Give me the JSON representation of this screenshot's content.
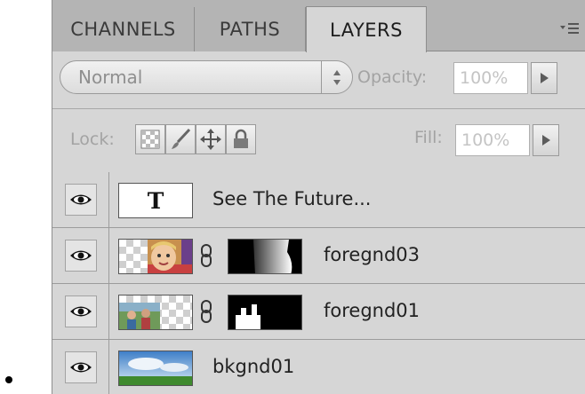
{
  "tabs": [
    {
      "label": "CHANNELS",
      "active": false
    },
    {
      "label": "PATHS",
      "active": false
    },
    {
      "label": "LAYERS",
      "active": true
    }
  ],
  "blend_mode": {
    "value": "Normal"
  },
  "opacity": {
    "label": "Opacity:",
    "value": "100%"
  },
  "lock": {
    "label": "Lock:",
    "buttons": [
      "lock-transparency-icon",
      "lock-paint-icon",
      "lock-move-icon",
      "lock-all-icon"
    ]
  },
  "fill": {
    "label": "Fill:",
    "value": "100%"
  },
  "layers": [
    {
      "name": "See The Future...",
      "type": "text",
      "thumb_glyph": "T",
      "visible": true,
      "has_mask": false
    },
    {
      "name": "foregnd03",
      "type": "image",
      "visible": true,
      "has_mask": true
    },
    {
      "name": "foregnd01",
      "type": "image",
      "visible": true,
      "has_mask": true
    },
    {
      "name": "bkgnd01",
      "type": "image",
      "visible": true,
      "has_mask": false
    }
  ],
  "colors": {
    "panel": "#d6d6d6",
    "tabbar": "#b4b4b4"
  }
}
